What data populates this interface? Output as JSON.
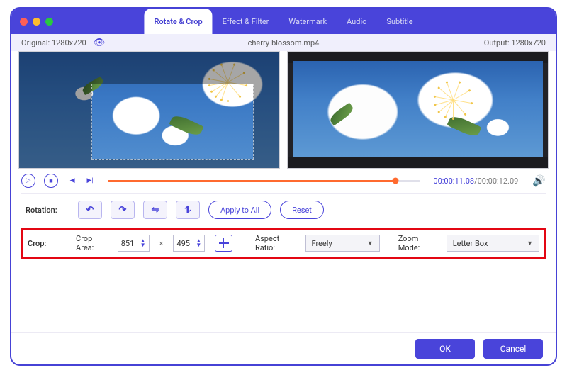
{
  "traffic_colors": [
    "#ff5f57",
    "#febc2e",
    "#28c840"
  ],
  "tabs": [
    "Rotate & Crop",
    "Effect & Filter",
    "Watermark",
    "Audio",
    "Subtitle"
  ],
  "active_tab_index": 0,
  "info": {
    "original_label": "Original: 1280x720",
    "filename": "cherry-blossom.mp4",
    "output_label": "Output: 1280x720"
  },
  "playback": {
    "current": "00:00:11.08",
    "total": "/00:00:12.09",
    "progress_pct": 92
  },
  "rotation": {
    "label": "Rotation:",
    "apply_all": "Apply to All",
    "reset": "Reset"
  },
  "crop": {
    "label": "Crop:",
    "area_label": "Crop Area:",
    "width": "851",
    "height": "495",
    "multiply": "×",
    "aspect_label": "Aspect Ratio:",
    "aspect_value": "Freely",
    "zoom_label": "Zoom Mode:",
    "zoom_value": "Letter Box"
  },
  "footer": {
    "ok": "OK",
    "cancel": "Cancel"
  }
}
